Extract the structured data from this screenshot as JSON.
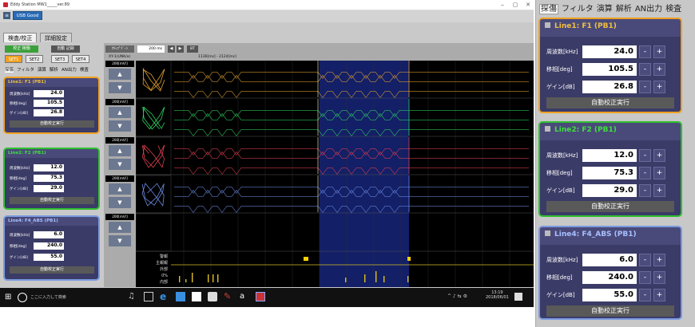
{
  "window": {
    "title": "Eddy Station MW1_____ver.89",
    "min": "‒",
    "max": "▢",
    "close": "✕"
  },
  "device_button": "USB Good",
  "main_tabs": [
    "検査/校正",
    "詳細設定"
  ],
  "left": {
    "mode_button": "校正 稼働",
    "auto_button": "自動 記録",
    "sets": [
      "SET1",
      "SET2",
      "SET3",
      "SET4"
    ],
    "menu": [
      "探傷",
      "フィルタ",
      "演算",
      "解析",
      "AN出力",
      "検査"
    ]
  },
  "panels": [
    {
      "title": "Line1: F1 (PB1)",
      "color": "#f0a020",
      "rows": [
        {
          "label": "周波数[kHz]",
          "value": "24.0"
        },
        {
          "label": "移相[deg]",
          "value": "105.5"
        },
        {
          "label": "ゲイン[dB]",
          "value": "26.8"
        }
      ],
      "minus": "-",
      "plus": "+",
      "run": "自動校正実行"
    },
    {
      "title": "Line2: F2 (PB1)",
      "color": "#2fc02f",
      "rows": [
        {
          "label": "周波数[kHz]",
          "value": "12.0"
        },
        {
          "label": "移相[deg]",
          "value": "75.3"
        },
        {
          "label": "ゲイン[dB]",
          "value": "29.0"
        }
      ],
      "minus": "-",
      "plus": "+",
      "run": "自動校正実行"
    },
    {
      "title": "Line4: F4_ABS (PB1)",
      "color": "#7a9ae0",
      "rows": [
        {
          "label": "周波数[kHz]",
          "value": "6.0"
        },
        {
          "label": "移相[deg]",
          "value": "240.0"
        },
        {
          "label": "ゲイン[dB]",
          "value": "55.0"
        }
      ],
      "minus": "-",
      "plus": "+",
      "run": "自動校正実行"
    }
  ],
  "scope": {
    "toolbar": {
      "label": "ｸﾘｯﾌﾟｿﾞｰﾝ",
      "input": "200 ms",
      "prev": "◀",
      "next": "▶",
      "extra": "BT"
    },
    "xy_label": "XY-1(UNK/α)",
    "time_range": "1136[ms] - 2124[ms]",
    "scales": [
      "200[mV/]",
      "200[mV/]",
      "200[mV/]",
      "200[mV/]",
      "200[mV/]"
    ],
    "channel_labels": [
      "警報",
      "主報報",
      "外部",
      "0%",
      "内部"
    ],
    "line_colors": [
      "#e0a030",
      "#30d060",
      "#e04050",
      "#6a8ae0",
      "#cccccc"
    ]
  },
  "taskbar": {
    "search": "ここに入力して検索",
    "time": "13:19",
    "date": "2018/06/01"
  }
}
